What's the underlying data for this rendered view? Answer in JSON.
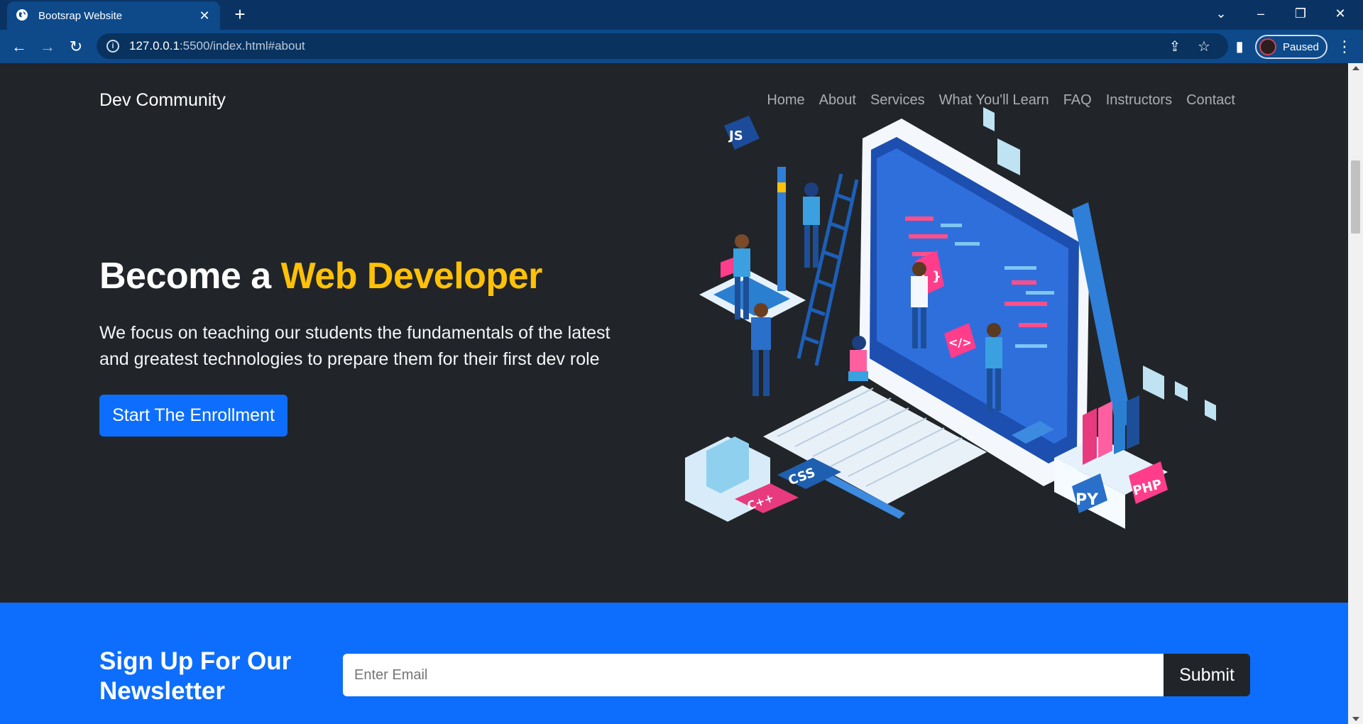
{
  "browser": {
    "tab_title": "Bootsrap Website",
    "url_host": "127.0.0.1",
    "url_path": ":5500/index.html#about",
    "profile_label": "Paused"
  },
  "navbar": {
    "brand": "Dev Community",
    "links": [
      "Home",
      "About",
      "Services",
      "What You'll Learn",
      "FAQ",
      "Instructors",
      "Contact"
    ]
  },
  "hero": {
    "title_prefix": "Become a ",
    "title_accent": "Web Developer",
    "text": "We focus on teaching our students the fundamentals of the latest and greatest technologies to prepare them for their first dev role",
    "cta_label": "Start The Enrollment",
    "illustration_labels": [
      "JS",
      "{ }",
      "</>",
      "CSS",
      "C++",
      "PY",
      "PHP"
    ]
  },
  "newsletter": {
    "title": "Sign Up For Our Newsletter",
    "email_placeholder": "Enter Email",
    "submit_label": "Submit"
  },
  "colors": {
    "page_bg": "#212529",
    "accent": "#ffc107",
    "primary": "#0d6efd",
    "chrome": "#0e4a8a"
  }
}
